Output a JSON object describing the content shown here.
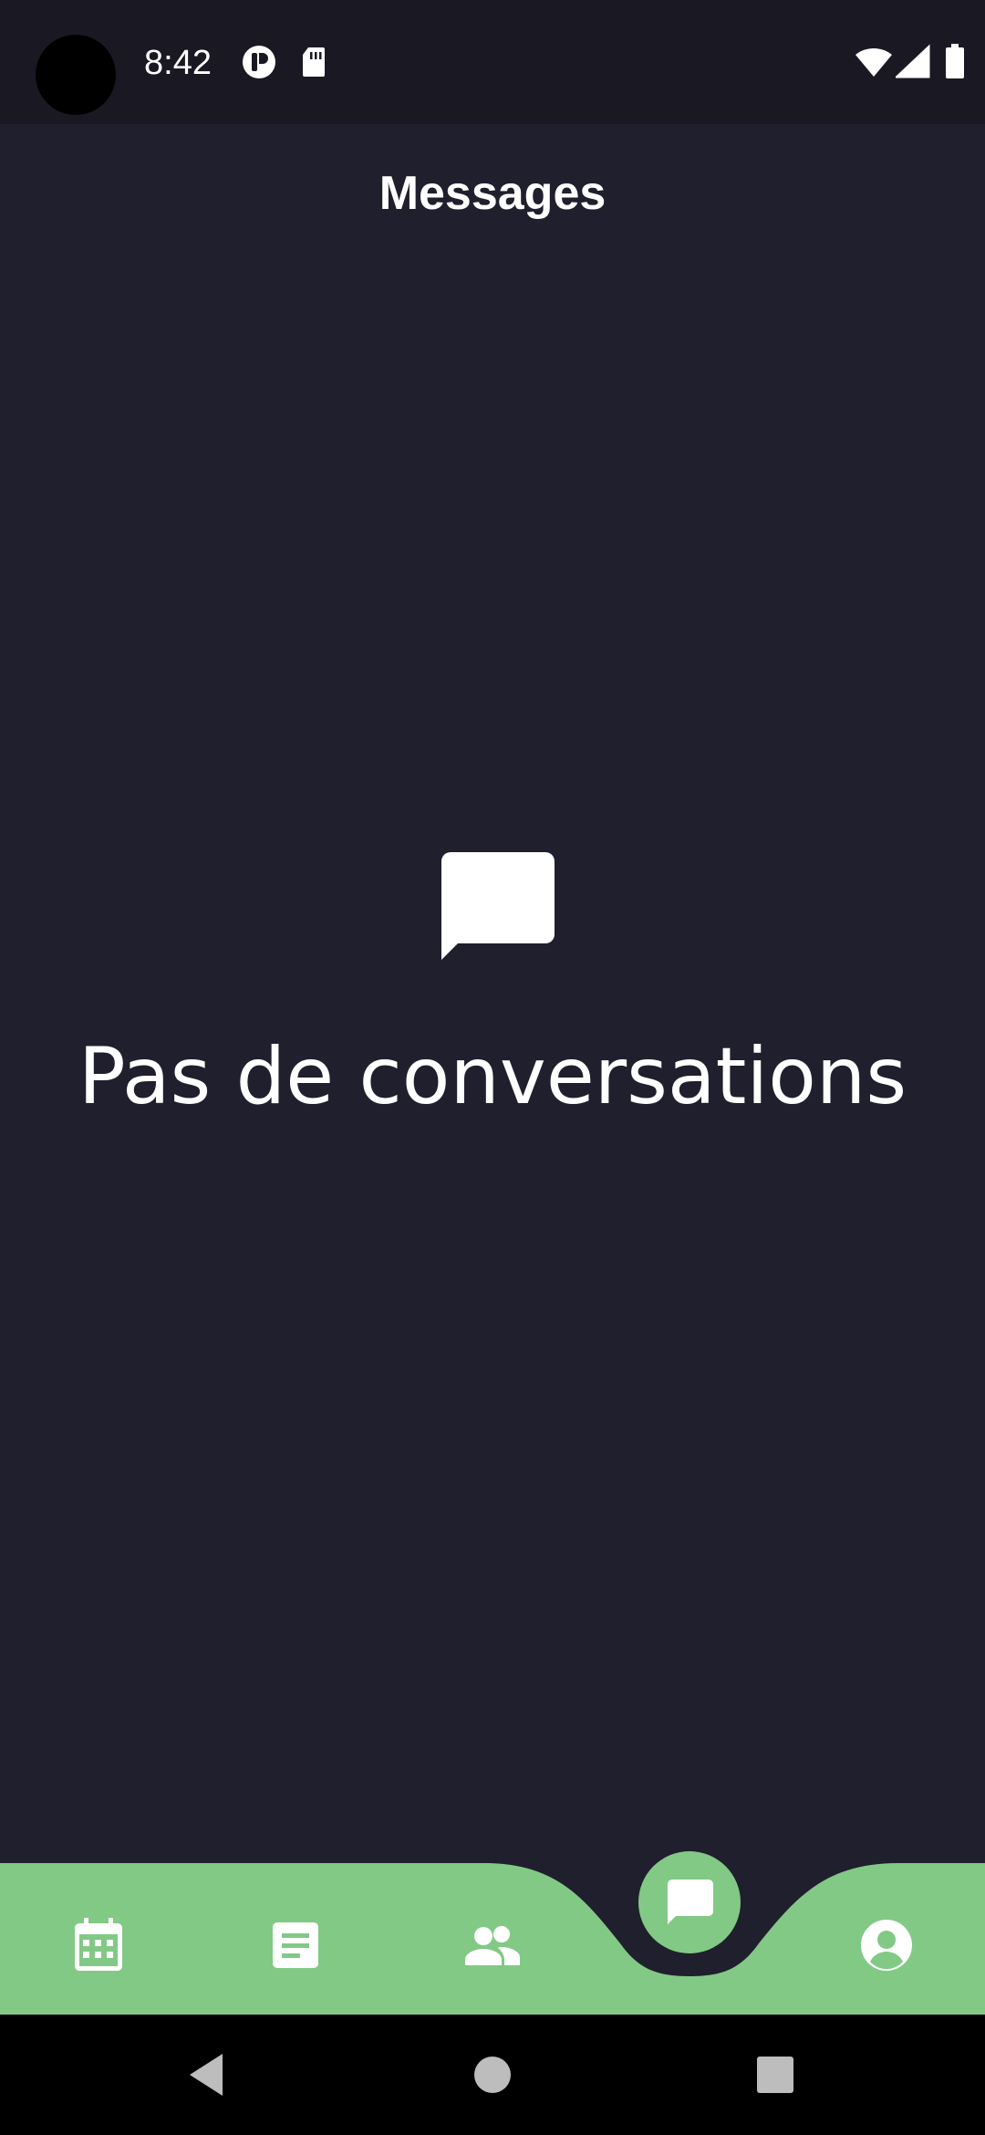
{
  "status_bar": {
    "time": "8:42",
    "icons": [
      "camera-cutout",
      "app-notification-icon",
      "sd-card-icon",
      "wifi-icon",
      "signal-icon",
      "battery-icon"
    ]
  },
  "header": {
    "title": "Messages"
  },
  "empty_state": {
    "icon": "chat-bubble-icon",
    "message": "Pas de conversations"
  },
  "bottom_nav": {
    "items": [
      {
        "icon": "calendar-icon",
        "active": false
      },
      {
        "icon": "document-icon",
        "active": false
      },
      {
        "icon": "people-icon",
        "active": false
      },
      {
        "icon": "chat-icon",
        "active": true
      },
      {
        "icon": "account-icon",
        "active": false
      }
    ]
  },
  "colors": {
    "background": "#201f2d",
    "status_bar": "#1a1923",
    "accent": "#82c985",
    "text": "#ffffff"
  }
}
